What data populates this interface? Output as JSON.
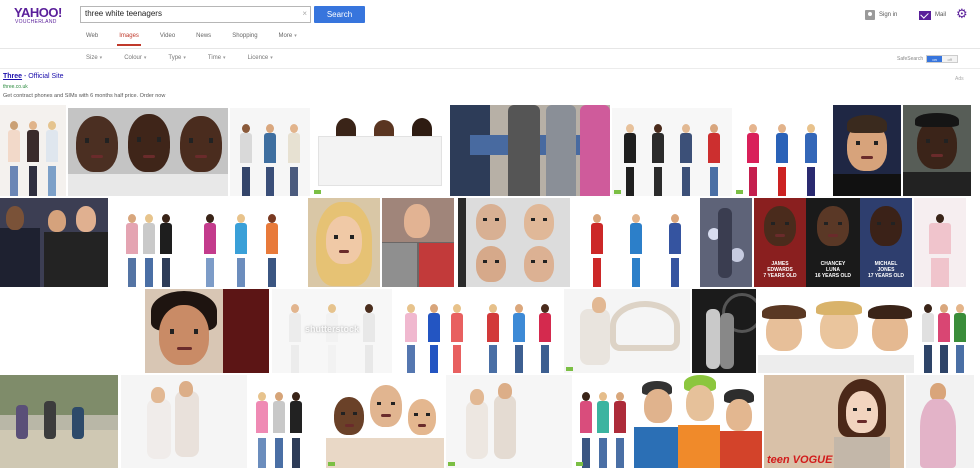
{
  "header": {
    "logo_main": "YAHOO!",
    "logo_sub": "VOUCHERLAND",
    "search_value": "three white teenagers",
    "search_clear": "×",
    "search_button": "Search",
    "sign_in": "Sign in",
    "mail": "Mail"
  },
  "tabs": [
    "Web",
    "Images",
    "Video",
    "News",
    "Shopping",
    "More"
  ],
  "active_tab": "Images",
  "filters": [
    "Size",
    "Colour",
    "Type",
    "Time",
    "Licence"
  ],
  "safesearch": {
    "label": "SafeSearch",
    "on": "on",
    "off": "off"
  },
  "ad": {
    "title_brand": "Three",
    "title_rest": " - Official Site",
    "url": "three.co.uk",
    "description": "Get contract phones and SIMs with 6 months half price. Order now",
    "label": "Ads"
  },
  "image_texts": {
    "watermark": "shutterstock",
    "poster_names": [
      "JAMES\nEDWARDS\n7 YEARS OLD",
      "CHANCEY\nLUNA\n16 YEARS OLD",
      "MICHAEL\nJONES\n17 YEARS OLD"
    ],
    "magazine": "teen VOGUE"
  },
  "colors": {
    "accent": "#5a1f9a",
    "search_button": "#3775dd",
    "active_tab": "#c0392b",
    "ad_link": "#1a0dab",
    "ad_url": "#2b8a3e"
  },
  "icons": [
    "user-icon",
    "mail-icon",
    "gear-icon"
  ]
}
